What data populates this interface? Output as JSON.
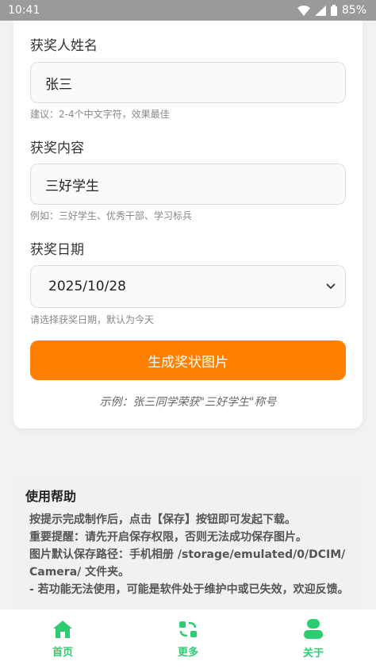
{
  "status": {
    "time": "10:41",
    "battery": "85%"
  },
  "form": {
    "name_label": "获奖人姓名",
    "name_value": "张三",
    "name_hint": "建议：2-4个中文字符，效果最佳",
    "content_label": "获奖内容",
    "content_value": "三好学生",
    "content_hint": "例如：三好学生、优秀干部、学习标兵",
    "date_label": "获奖日期",
    "date_value": "2025/10/28",
    "date_hint": "请选择获奖日期，默认为今天",
    "generate_label": "生成奖状图片",
    "example": "示例：张三同学荣获\"三好学生\"称号"
  },
  "help": {
    "title": "使用帮助",
    "lines": [
      "按提示完成制作后，点击【保存】按钮即可发起下载。",
      "重要提醒：请先开启保存权限，否则无法成功保存图片。",
      "图片默认保存路径：手机相册 /storage/emulated/0/DCIM/ Camera/ 文件夹。",
      "- 若功能无法使用，可能是软件处于维护中或已失效，欢迎反馈。"
    ]
  },
  "nav": {
    "home": "首页",
    "more": "更多",
    "about": "关于"
  },
  "colors": {
    "accent": "#ff8000",
    "nav": "#2ecc71"
  }
}
